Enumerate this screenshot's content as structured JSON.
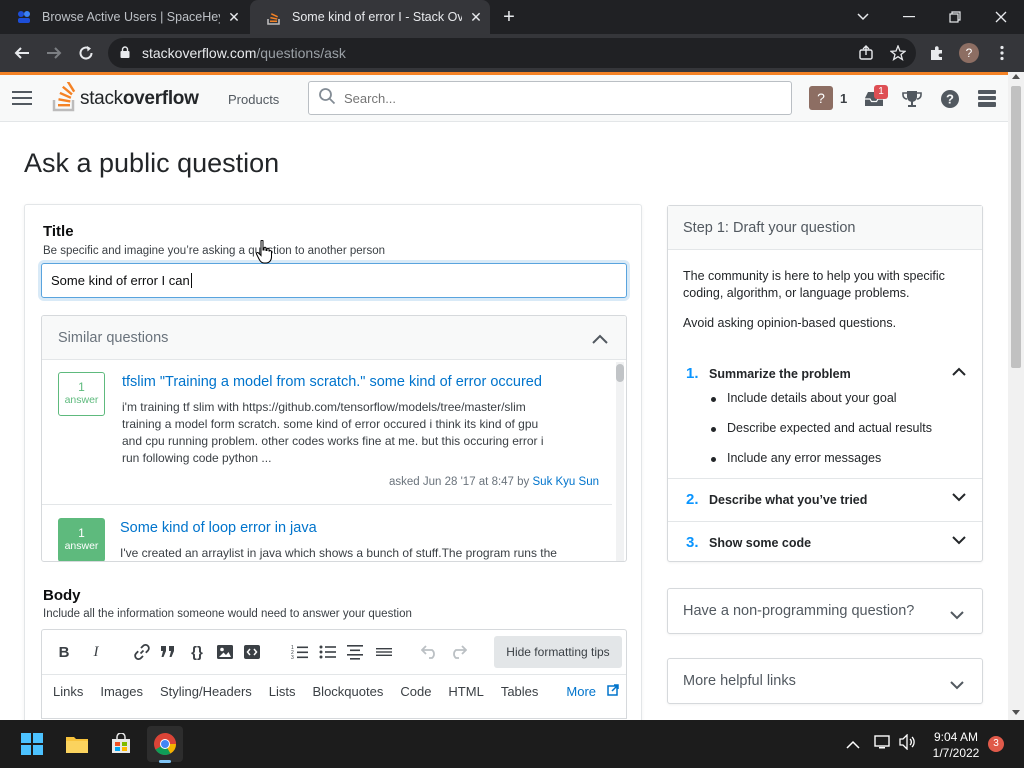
{
  "browser": {
    "tabs": [
      {
        "title": "Browse Active Users | SpaceHey",
        "active": false
      },
      {
        "title": "Some kind of error I - Stack Over",
        "active": true
      }
    ],
    "new_tab": "+",
    "url_host": "stackoverflow.com",
    "url_path": "/questions/ask",
    "profile_initial": "?"
  },
  "so_header": {
    "logo_light": "stack",
    "logo_bold": "overflow",
    "products": "Products",
    "search_placeholder": "Search...",
    "reputation": "1",
    "inbox_badge": "1",
    "avatar_initial": "?"
  },
  "page": {
    "title": "Ask a public question"
  },
  "title_section": {
    "label": "Title",
    "hint": "Be specific and imagine you’re asking a question to another person",
    "value": "Some kind of error I can"
  },
  "similar": {
    "heading": "Similar questions",
    "items": [
      {
        "answers": "1",
        "answer_word": "answer",
        "accepted": false,
        "title": "tfslim \"Training a model from scratch.\" some kind of error occured",
        "excerpt_lines": [
          "i'm training tf slim with https://github.com/tensorflow/models/tree/master/slim",
          "training a model form scratch. some kind of error occured i think its kind of gpu",
          "and cpu running problem. other codes works fine at me. but this occuring error i",
          "run following code python ..."
        ],
        "asked": "asked Jun 28 '17 at 8:47 by",
        "author": "Suk Kyu Sun"
      },
      {
        "answers": "1",
        "answer_word": "answer",
        "accepted": true,
        "title": "Some kind of loop error in java",
        "excerpt_lines": [
          "I've created an arraylist in java which shows a bunch of stuff.The program runs the"
        ]
      }
    ]
  },
  "body_section": {
    "label": "Body",
    "hint": "Include all the information someone would need to answer your question",
    "hide_tips": "Hide formatting tips",
    "help_links": [
      "Links",
      "Images",
      "Styling/Headers",
      "Lists",
      "Blockquotes",
      "Code",
      "HTML",
      "Tables"
    ],
    "more": "More"
  },
  "sidebar": {
    "step_heading": "Step 1: Draft your question",
    "intro": [
      "The community is here to help you with specific",
      "coding, algorithm, or language problems."
    ],
    "avoid": "Avoid asking opinion-based questions.",
    "steps": [
      {
        "num": "1.",
        "label": "Summarize the problem"
      },
      {
        "num": "2.",
        "label": "Describe what you’ve tried"
      },
      {
        "num": "3.",
        "label": "Show some code"
      }
    ],
    "bullets": [
      "Include details about your goal",
      "Describe expected and actual results",
      "Include any error messages"
    ],
    "non_programming": "Have a non-programming question?",
    "more_links": "More helpful links"
  },
  "taskbar": {
    "time": "9:04 AM",
    "date": "1/7/2022",
    "notifications": "3"
  },
  "colors": {
    "so_orange": "#f48225",
    "link_blue": "#0074cc",
    "accepted_green": "#5eba7d"
  }
}
